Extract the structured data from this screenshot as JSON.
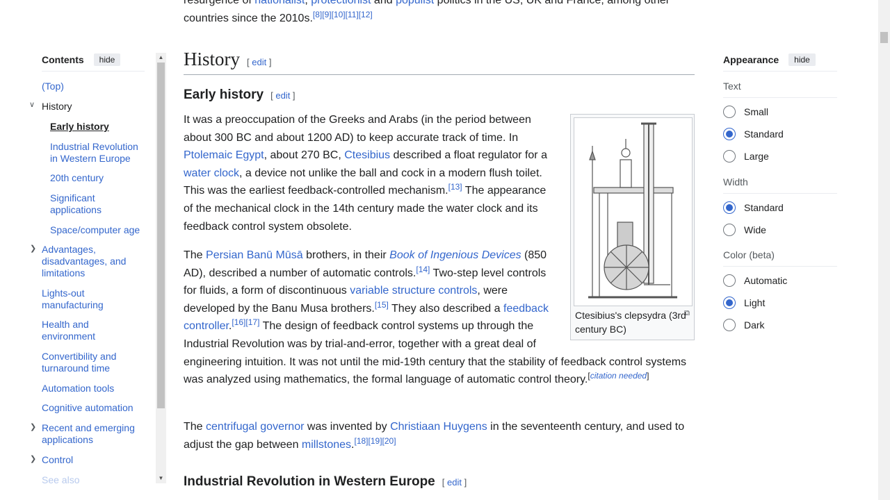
{
  "intro": {
    "line1_pre": "resurgence of ",
    "link_nationalist": "nationalist",
    "comma": ", ",
    "link_protectionist": "protectionist",
    "and": " and ",
    "link_populist": "populist",
    "line1_post": " politics in the US, UK and France, among other",
    "line2": "countries since the 2010s.",
    "refs": "[8][9][10][11][12]"
  },
  "toc": {
    "title": "Contents",
    "hide_label": "hide",
    "items": [
      {
        "label": "(Top)"
      },
      {
        "label": "History"
      },
      {
        "label": "Early history"
      },
      {
        "label": "Industrial Revolution in Western Europe"
      },
      {
        "label": "20th century"
      },
      {
        "label": "Significant applications"
      },
      {
        "label": "Space/computer age"
      },
      {
        "label": "Advantages, disadvantages, and limitations"
      },
      {
        "label": "Lights-out manufacturing"
      },
      {
        "label": "Health and environment"
      },
      {
        "label": "Convertibility and turnaround time"
      },
      {
        "label": "Automation tools"
      },
      {
        "label": "Cognitive automation"
      },
      {
        "label": "Recent and emerging applications"
      },
      {
        "label": "Control"
      },
      {
        "label": "See also"
      }
    ]
  },
  "section": {
    "title": "History",
    "edit_open": "[ ",
    "edit_label": "edit",
    "edit_close": " ]"
  },
  "early": {
    "title": "Early history",
    "p1": {
      "t1": "It was a preoccupation of the Greeks and Arabs (in the period between about 300 BC and about 1200 AD) to keep accurate track of time. In ",
      "l1": "Ptolemaic Egypt",
      "t2": ", about 270 BC, ",
      "l2": "Ctesibius",
      "t3": " described a float regulator for a ",
      "l3": "water clock",
      "t4": ", a device not unlike the ball and cock in a modern flush toilet. This was the earliest feedback-controlled mechanism.",
      "r1": "[13]",
      "t5": " The appearance of the mechanical clock in the 14th century made the water clock and its feedback control system obsolete."
    },
    "p2": {
      "t1": "The ",
      "l1": "Persian Banū Mūsā",
      "t2": " brothers, in their ",
      "l2": "Book of Ingenious Devices",
      "t3": " (850 AD), described a number of automatic controls.",
      "r1": "[14]",
      "t4": " Two-step level controls for fluids, a form of discontinuous ",
      "l3": "variable structure controls",
      "t5": ", were developed by the Banu Musa brothers.",
      "r2": "[15]",
      "t6": " They also described a ",
      "l4": "feedback controller",
      "t7": ".",
      "r3": "[16][17]",
      "t8": " The design of feedback control systems up through the Industrial Revolution was by trial-and-error, together with a great deal of engineering intuition. It was not until the mid-19th century that the stability of feedback control systems was analyzed using mathematics, the formal language of automatic control theory.",
      "cn_open": "[",
      "cn": "citation needed",
      "cn_close": "]"
    },
    "p3": {
      "t1": "The ",
      "l1": "centrifugal governor",
      "t2": " was invented by ",
      "l2": "Christiaan Huygens",
      "t3": " in the seventeenth century, and used to adjust the gap between ",
      "l3": "millstones",
      "t4": ".",
      "r1": "[18][19][20]"
    }
  },
  "figure": {
    "caption": "Ctesibius's clepsydra (3rd century BC)",
    "enlarge_icon": "enlarge-icon"
  },
  "industrial": {
    "title": "Industrial Revolution in Western Europe"
  },
  "appearance": {
    "title": "Appearance",
    "hide_label": "hide",
    "text_label": "Text",
    "text_options": [
      {
        "label": "Small",
        "selected": false
      },
      {
        "label": "Standard",
        "selected": true
      },
      {
        "label": "Large",
        "selected": false
      }
    ],
    "width_label": "Width",
    "width_options": [
      {
        "label": "Standard",
        "selected": true
      },
      {
        "label": "Wide",
        "selected": false
      }
    ],
    "color_label": "Color (beta)",
    "color_options": [
      {
        "label": "Automatic",
        "selected": false
      },
      {
        "label": "Light",
        "selected": true
      },
      {
        "label": "Dark",
        "selected": false
      }
    ]
  },
  "colors": {
    "link": "#3366cc",
    "text": "#202122",
    "muted": "#54595d",
    "border": "#a2a9b1"
  }
}
